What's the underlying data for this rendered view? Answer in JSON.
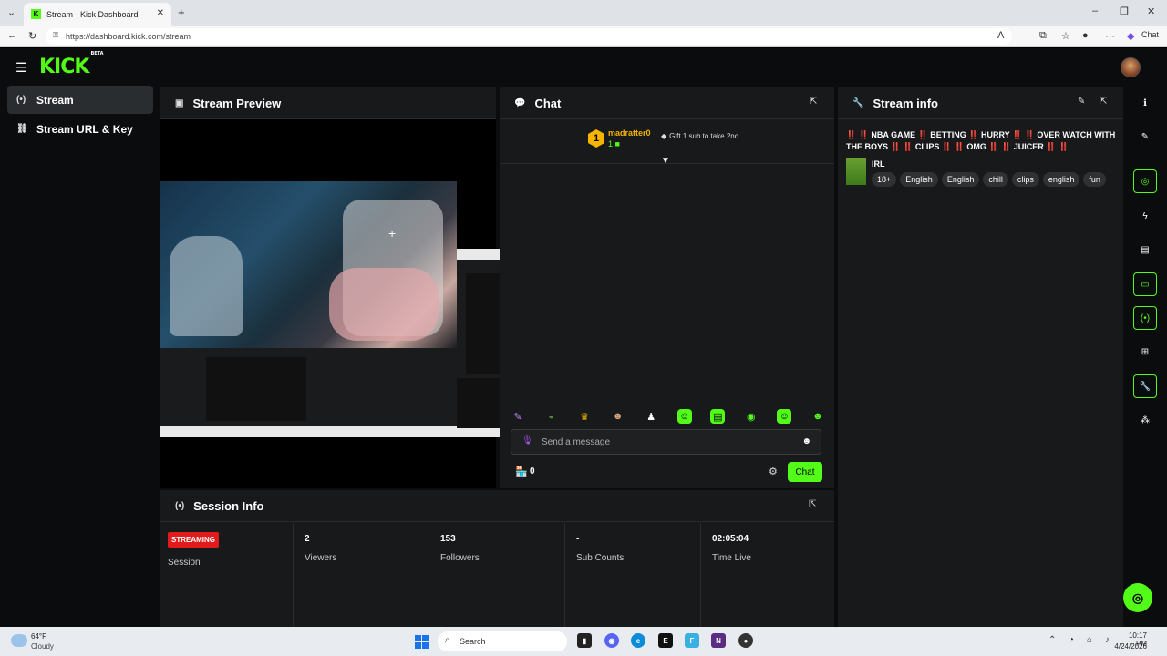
{
  "browser": {
    "tab_title": "Stream - Kick Dashboard",
    "url": "https://dashboard.kick.com/stream",
    "chat_label": "Chat"
  },
  "app": {
    "logo": "KICK",
    "logo_sup": "BETA"
  },
  "sidebar": {
    "items": [
      {
        "label": "Stream",
        "icon": "broadcast-icon"
      },
      {
        "label": "Stream URL & Key",
        "icon": "link-icon"
      }
    ]
  },
  "preview": {
    "title": "Stream Preview"
  },
  "chat": {
    "title": "Chat",
    "gift_rank": "1",
    "gifter": "madratter0",
    "gift_count": "1",
    "gift_message": "Gift 1 sub to take 2nd",
    "placeholder": "Send a message",
    "points": "0",
    "send_label": "Chat"
  },
  "stream_info": {
    "title": "Stream info",
    "stream_title": "‼️ ‼️ NBA GAME ‼️ BETTING ‼️ HURRY ‼️ ‼️ OVER WATCH WITH THE BOYS ‼️ ‼️ CLIPS ‼️ ‼️ OMG ‼️ ‼️ JUICER ‼️ ‼️",
    "category": "IRL",
    "tags": [
      "18+",
      "English",
      "English",
      "chill",
      "clips",
      "english",
      "fun"
    ]
  },
  "session": {
    "title": "Session Info",
    "status_badge": "STREAMING",
    "status_label": "Session",
    "stats": [
      {
        "value": "2",
        "label": "Viewers"
      },
      {
        "value": "153",
        "label": "Followers"
      },
      {
        "value": "-",
        "label": "Sub Counts"
      },
      {
        "value": "02:05:04",
        "label": "Time Live"
      }
    ]
  },
  "taskbar": {
    "temp": "64°F",
    "condition": "Cloudy",
    "search": "Search",
    "time": "10:17 PM",
    "date": "4/24/2026"
  },
  "colors": {
    "accent": "#53fc18",
    "live": "#e11b1b",
    "panel": "#18191b",
    "background": "#0b0c0d"
  }
}
